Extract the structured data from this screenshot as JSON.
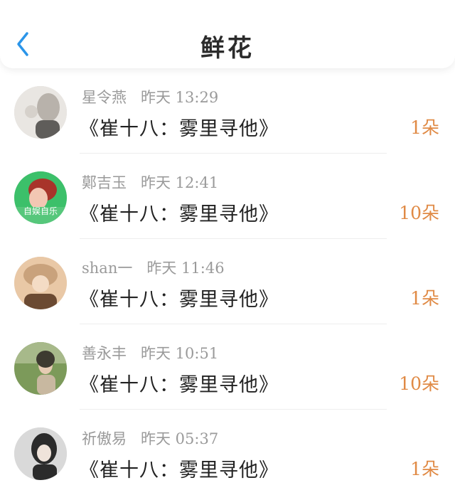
{
  "header": {
    "title": "鲜花",
    "back_icon": "chevron-left-icon",
    "accent": "#2b95e9"
  },
  "gifts": [
    {
      "user": "星令燕",
      "time": "昨天 13:29",
      "work": "《崔十八：雾里寻他》",
      "count": "1朵",
      "avatar_palette": [
        "#e9e6e2",
        "#b8b2ab",
        "#5f5d5a"
      ]
    },
    {
      "user": "鄚吉玉",
      "time": "昨天 12:41",
      "work": "《崔十八：雾里寻他》",
      "count": "10朵",
      "avatar_palette": [
        "#3cc06a",
        "#c0392b",
        "#f2c7b3"
      ],
      "avatar_text": "自娱自乐"
    },
    {
      "user": "shan一",
      "time": "昨天 11:46",
      "work": "《崔十八：雾里寻他》",
      "count": "1朵",
      "avatar_palette": [
        "#e9c8a6",
        "#c9a27c",
        "#6b4a32"
      ]
    },
    {
      "user": "善永丰",
      "time": "昨天 10:51",
      "work": "《崔十八：雾里寻他》",
      "count": "10朵",
      "avatar_palette": [
        "#7c9a5a",
        "#c8b8a0",
        "#3d3a30"
      ]
    },
    {
      "user": "祈傲易",
      "time": "昨天 05:37",
      "work": "《崔十八：雾里寻他》",
      "count": "1朵",
      "avatar_palette": [
        "#d9d9d9",
        "#2b2b2b",
        "#efe3da"
      ]
    }
  ]
}
